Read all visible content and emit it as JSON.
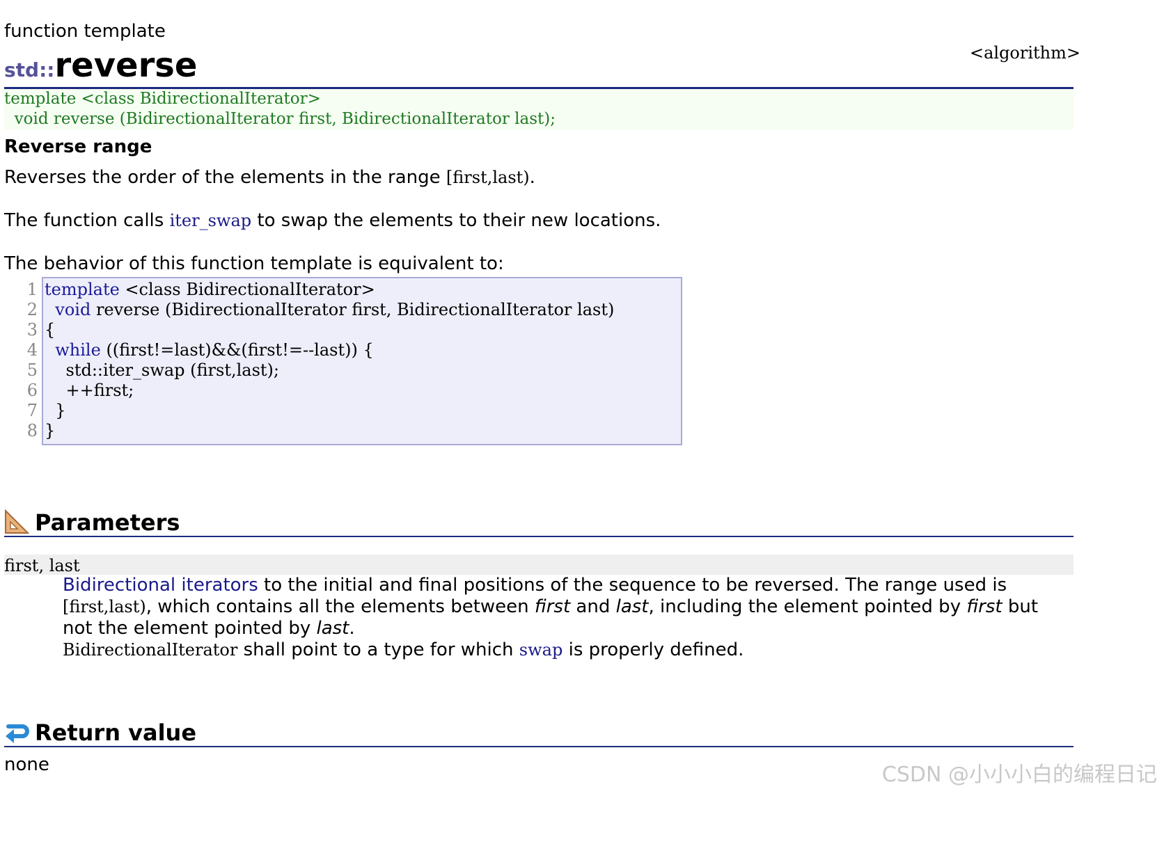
{
  "page": {
    "kind": "function template",
    "namespace": "std::",
    "name": "reverse",
    "header": "<algorithm>"
  },
  "prototype": {
    "line1": "template <class BidirectionalIterator>",
    "line2": "  void reverse (BidirectionalIterator first, BidirectionalIterator last);"
  },
  "summary": {
    "heading": "Reverse range",
    "p1_text": "Reverses the order of the elements in the range ",
    "p1_code": "[first,last)",
    "p1_end": ".",
    "p2_text": "The function calls ",
    "p2_link": "iter_swap",
    "p2_end": " to swap the elements to their new locations.",
    "p3_text": "The behavior of this function template is equivalent to:"
  },
  "code": {
    "line_numbers": [
      "1",
      "2",
      "3",
      "4",
      "5",
      "6",
      "7",
      "8"
    ],
    "lines": [
      {
        "kw": "template",
        "rest": " <class BidirectionalIterator>"
      },
      {
        "kw": "  void",
        "rest": " reverse (BidirectionalIterator first, BidirectionalIterator last)"
      },
      {
        "kw": "",
        "rest": "{"
      },
      {
        "kw": "  while",
        "rest": " ((first!=last)&&(first!=--last)) {"
      },
      {
        "kw": "",
        "rest": "    std::iter_swap (first,last);"
      },
      {
        "kw": "",
        "rest": "    ++first;"
      },
      {
        "kw": "",
        "rest": "  }"
      },
      {
        "kw": "",
        "rest": "}"
      }
    ]
  },
  "parameters": {
    "heading": "Parameters",
    "name": "first, last",
    "d1_link": "Bidirectional iterators",
    "d1_text": " to the initial and final positions of the sequence to be reversed. The range used is ",
    "d1_code": "[first,last)",
    "d1_text2": ", which contains all the elements between ",
    "d1_em1": "first",
    "d1_text3": " and ",
    "d1_em2": "last",
    "d1_text4": ", including the element pointed by ",
    "d1_em3": "first",
    "d1_text5": " but not the element pointed by ",
    "d1_em4": "last",
    "d1_text6": ".",
    "d2_code": "BidirectionalIterator",
    "d2_text": " shall point to a type for which ",
    "d2_link": "swap",
    "d2_text2": " is properly defined."
  },
  "return_value": {
    "heading": "Return value",
    "text": "none"
  },
  "watermark": "CSDN @小小小白的编程日记",
  "icons": {
    "parameters": "ruler-triangle-icon",
    "return": "return-arrow-icon"
  }
}
